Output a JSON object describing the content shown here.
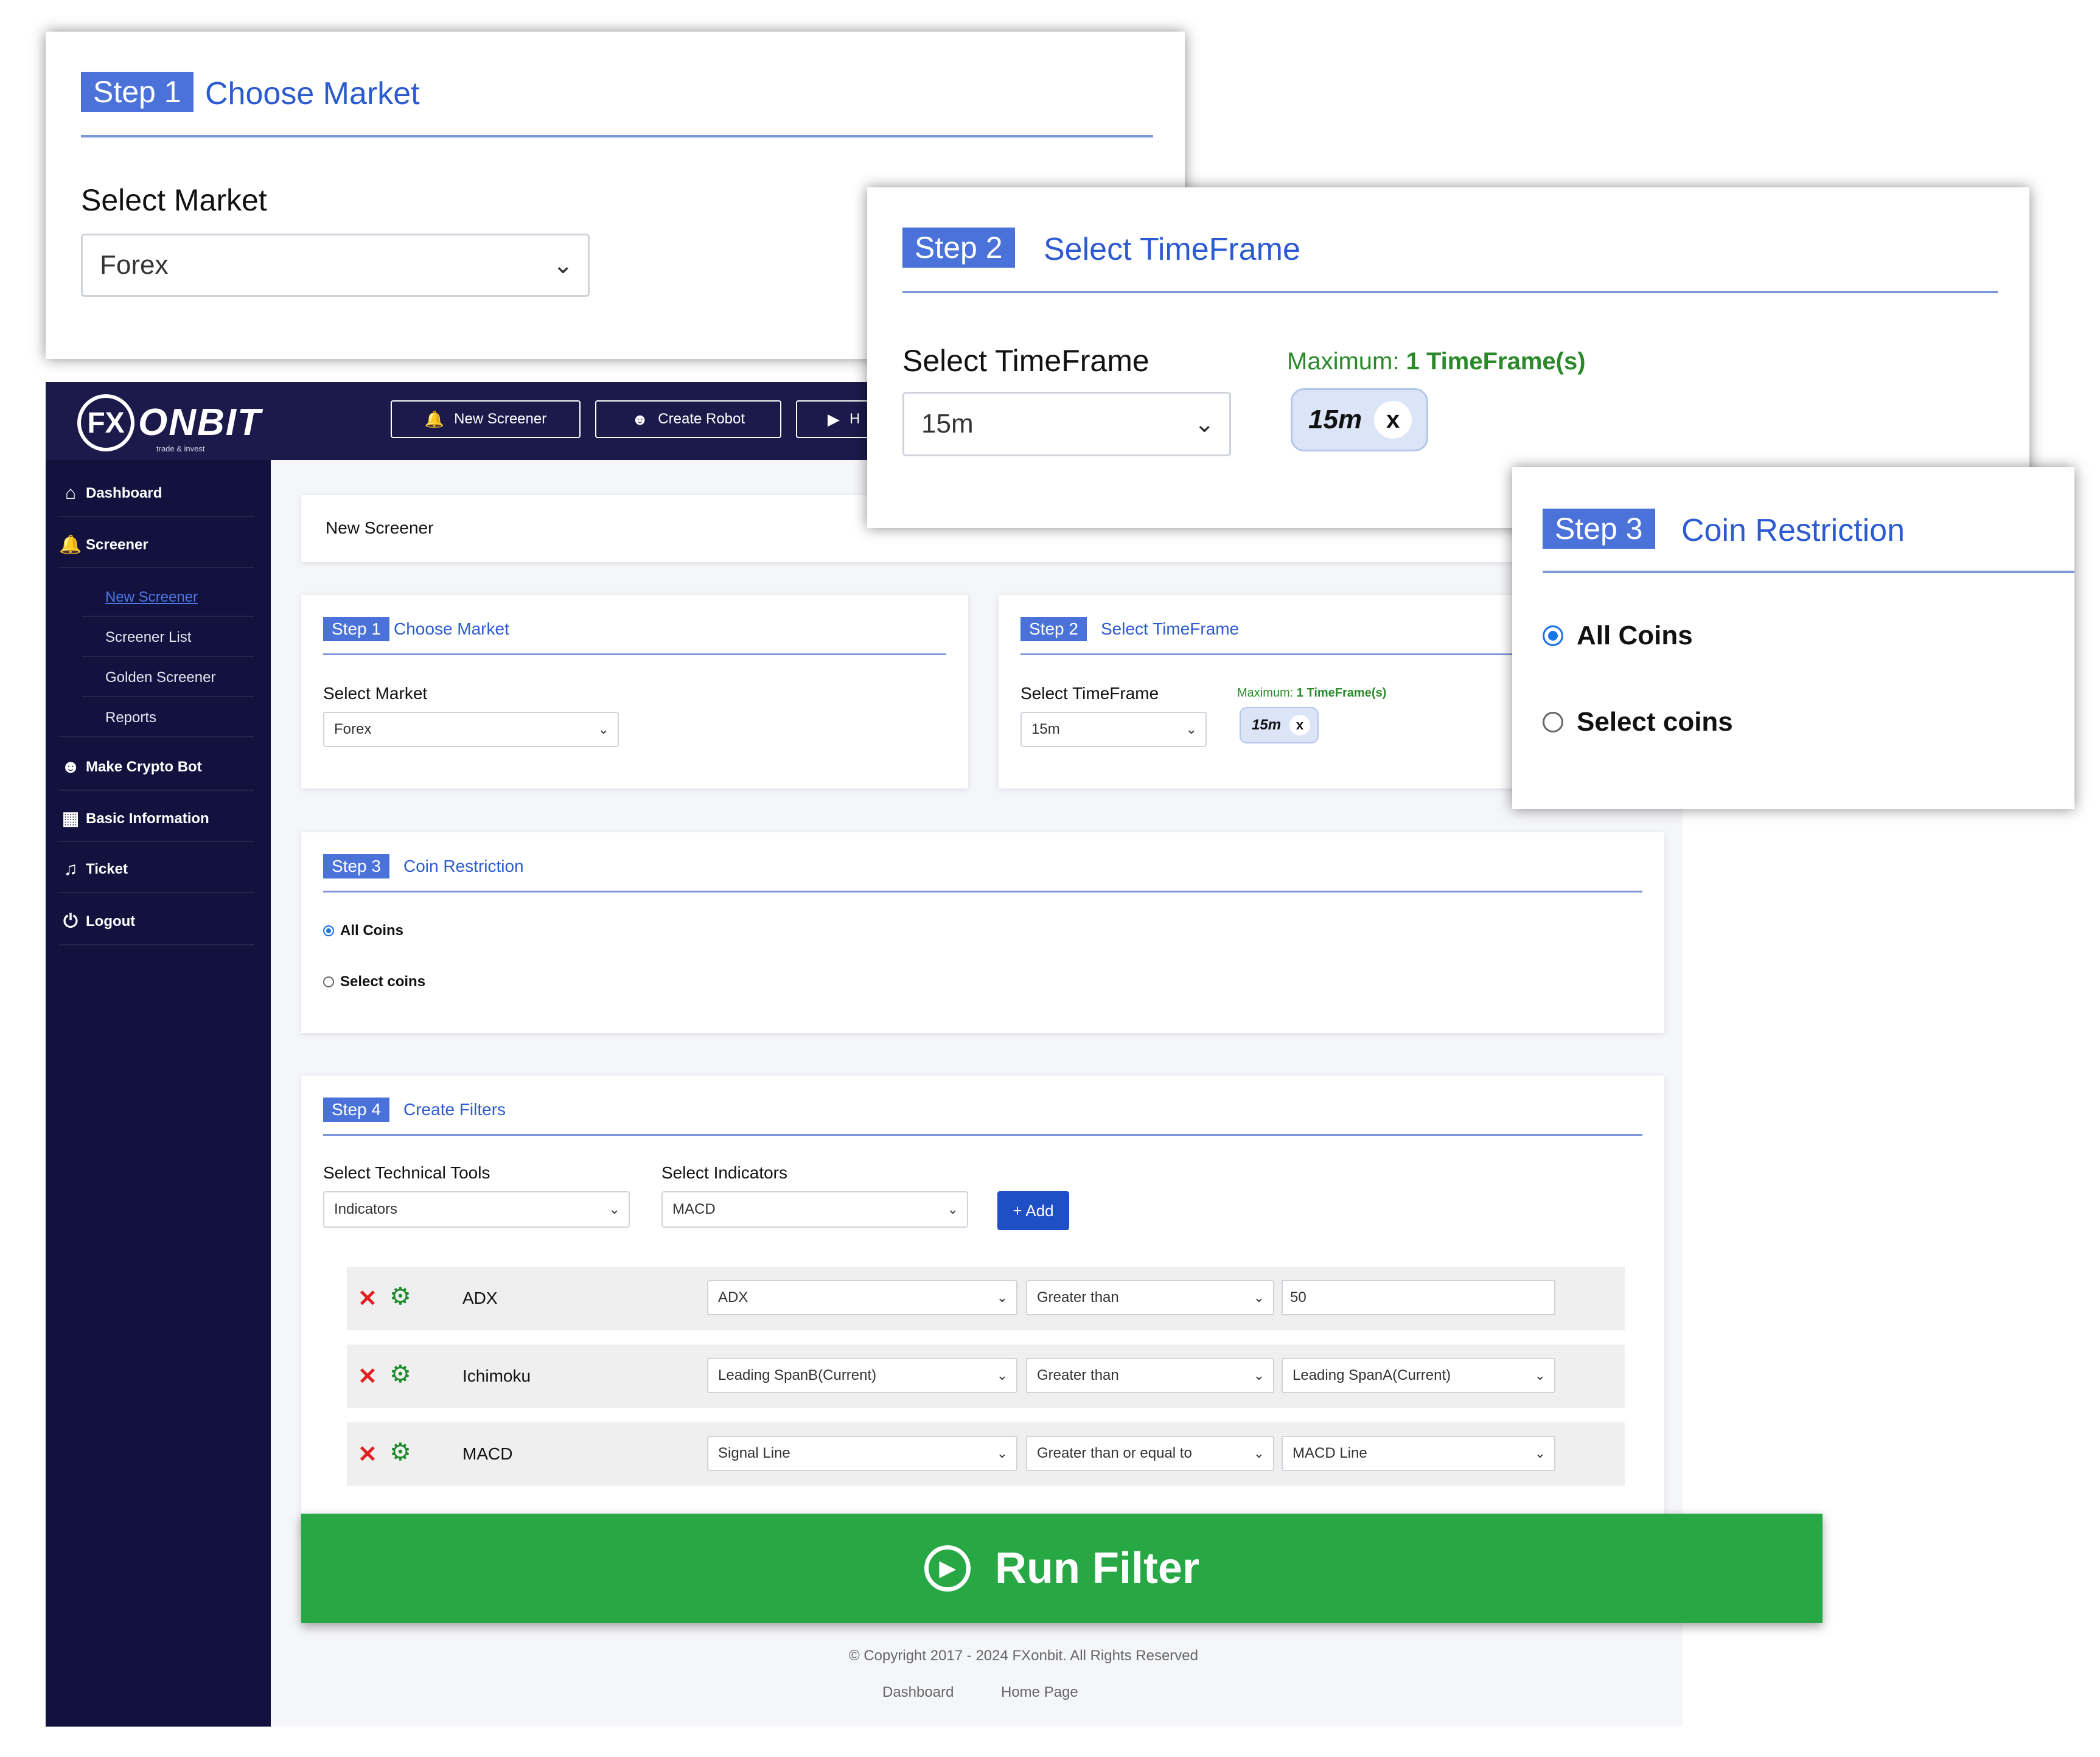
{
  "app": {
    "logo": {
      "mark": "FX",
      "word": "ONBIT",
      "tagline": "trade & invest"
    },
    "topbar": {
      "buttons": [
        {
          "label": "New Screener",
          "icon": "bell-icon"
        },
        {
          "label": "Create Robot",
          "icon": "robot-icon"
        },
        {
          "label": "H",
          "icon": "play-icon"
        }
      ]
    },
    "sidebar": {
      "items": [
        {
          "label": "Dashboard",
          "icon": "home-icon"
        },
        {
          "label": "Screener",
          "icon": "bell-icon"
        },
        {
          "label": "Make Crypto Bot",
          "icon": "robot-icon"
        },
        {
          "label": "Basic Information",
          "icon": "grid-icon"
        },
        {
          "label": "Ticket",
          "icon": "ticket-icon"
        },
        {
          "label": "Logout",
          "icon": "power-icon"
        }
      ],
      "sub_items": [
        "New Screener",
        "Screener List",
        "Golden Screener",
        "Reports"
      ]
    },
    "page_title": "New Screener",
    "step1": {
      "badge": "Step 1",
      "title": "Choose Market",
      "label": "Select Market",
      "value": "Forex"
    },
    "step2": {
      "badge": "Step 2",
      "title": "Select TimeFrame",
      "label": "Select TimeFrame",
      "value": "15m",
      "max_prefix": "Maximum: ",
      "max_value": "1 TimeFrame(s)",
      "chip": "15m",
      "chip_x": "x"
    },
    "step3": {
      "badge": "Step 3",
      "title": "Coin Restriction",
      "options": [
        "All Coins",
        "Select coins"
      ],
      "selected": "All Coins"
    },
    "step4": {
      "badge": "Step 4",
      "title": "Create Filters",
      "tools_label": "Select Technical Tools",
      "tools_value": "Indicators",
      "indicators_label": "Select Indicators",
      "indicators_value": "MACD",
      "add_label": "+ Add",
      "filters": [
        {
          "name": "ADX",
          "field1": "ADX",
          "operator": "Greater than",
          "field2": "50"
        },
        {
          "name": "Ichimoku",
          "field1": "Leading SpanB(Current)",
          "operator": "Greater than",
          "field2": "Leading SpanA(Current)"
        },
        {
          "name": "MACD",
          "field1": "Signal Line",
          "operator": "Greater than or equal to",
          "field2": "MACD Line"
        }
      ]
    },
    "run_filter": "Run Filter",
    "footer": {
      "copyright": "© Copyright 2017 - 2024 FXonbit. All Rights Reserved",
      "links": [
        "Dashboard",
        "Home Page"
      ]
    }
  },
  "colors": {
    "sidebar": "#13123f",
    "topbar": "#1b1a4a",
    "accent": "#4a72d8",
    "run": "#28a745",
    "max_text": "#2a8a2a"
  }
}
